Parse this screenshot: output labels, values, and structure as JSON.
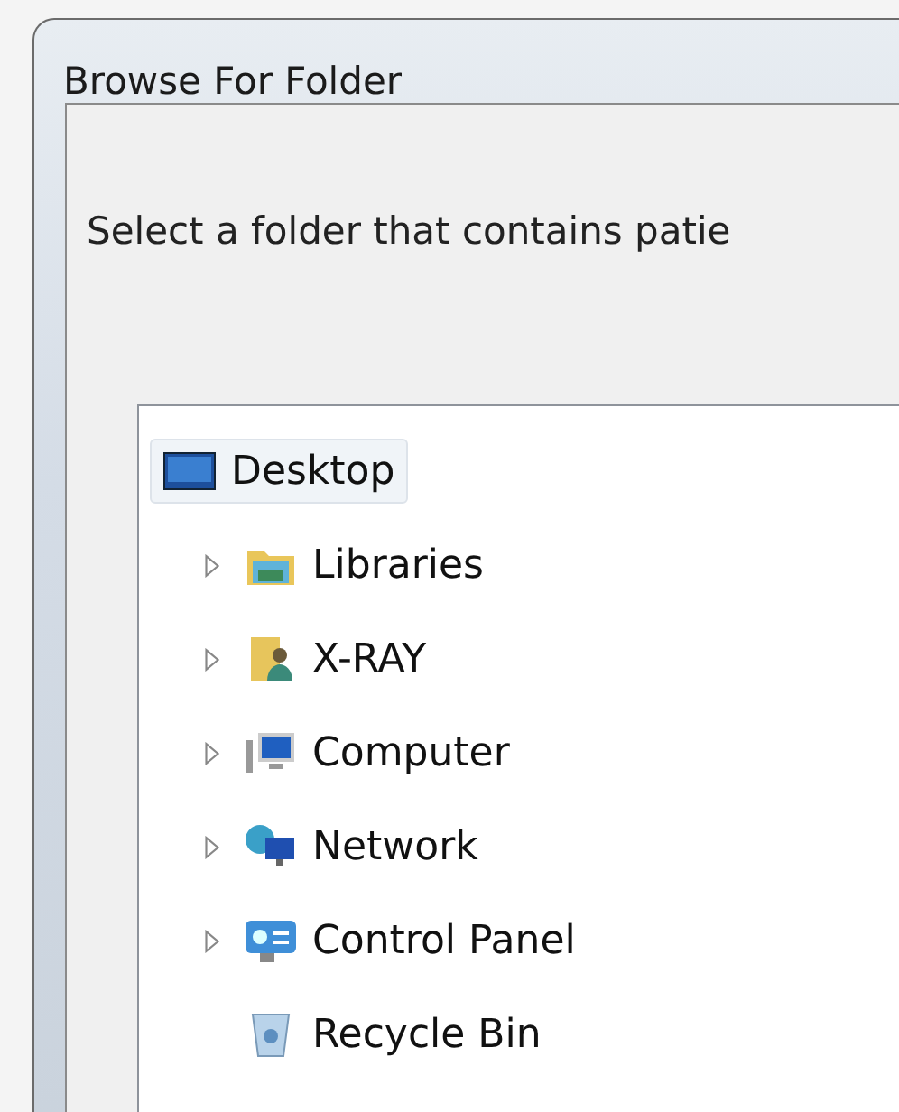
{
  "window": {
    "title": "Browse For Folder"
  },
  "instruction": "Select a folder that contains patie",
  "tree": [
    {
      "label": "Desktop",
      "kind": "desktop",
      "selected": true,
      "children": [
        {
          "label": "Libraries",
          "kind": "libraries",
          "selected": false,
          "expandable": true
        },
        {
          "label": "X-RAY",
          "kind": "user-folder",
          "selected": false,
          "expandable": true
        },
        {
          "label": "Computer",
          "kind": "computer",
          "selected": false,
          "expandable": true
        },
        {
          "label": "Network",
          "kind": "network",
          "selected": false,
          "expandable": true
        },
        {
          "label": "Control Panel",
          "kind": "control-panel",
          "selected": false,
          "expandable": true
        },
        {
          "label": "Recycle Bin",
          "kind": "recycle-bin",
          "selected": false,
          "expandable": false
        }
      ]
    }
  ]
}
